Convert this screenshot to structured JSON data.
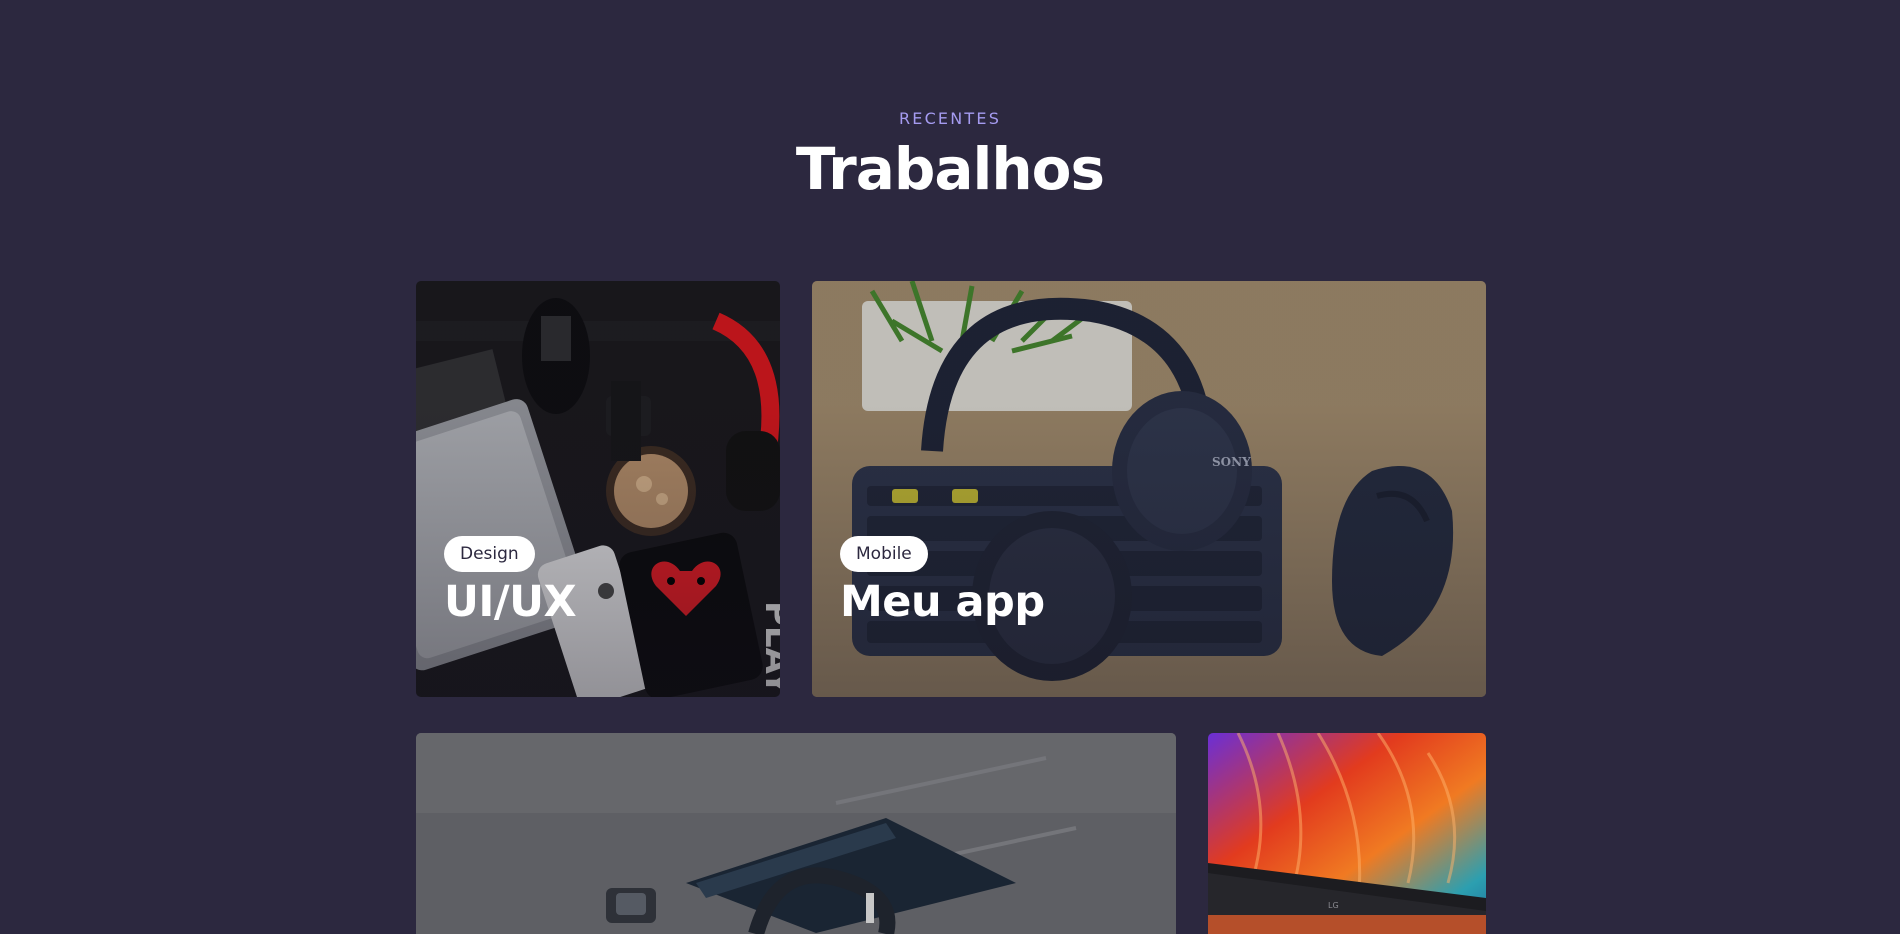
{
  "section": {
    "eyebrow": "RECENTES",
    "title": "Trabalhos"
  },
  "cards": [
    {
      "tag": "Design",
      "title": "UI/UX"
    },
    {
      "tag": "Mobile",
      "title": "Meu app"
    }
  ],
  "colors": {
    "background": "#2c283f",
    "eyebrow": "#a59bf0",
    "tag_bg": "#ffffff",
    "text": "#ffffff"
  }
}
